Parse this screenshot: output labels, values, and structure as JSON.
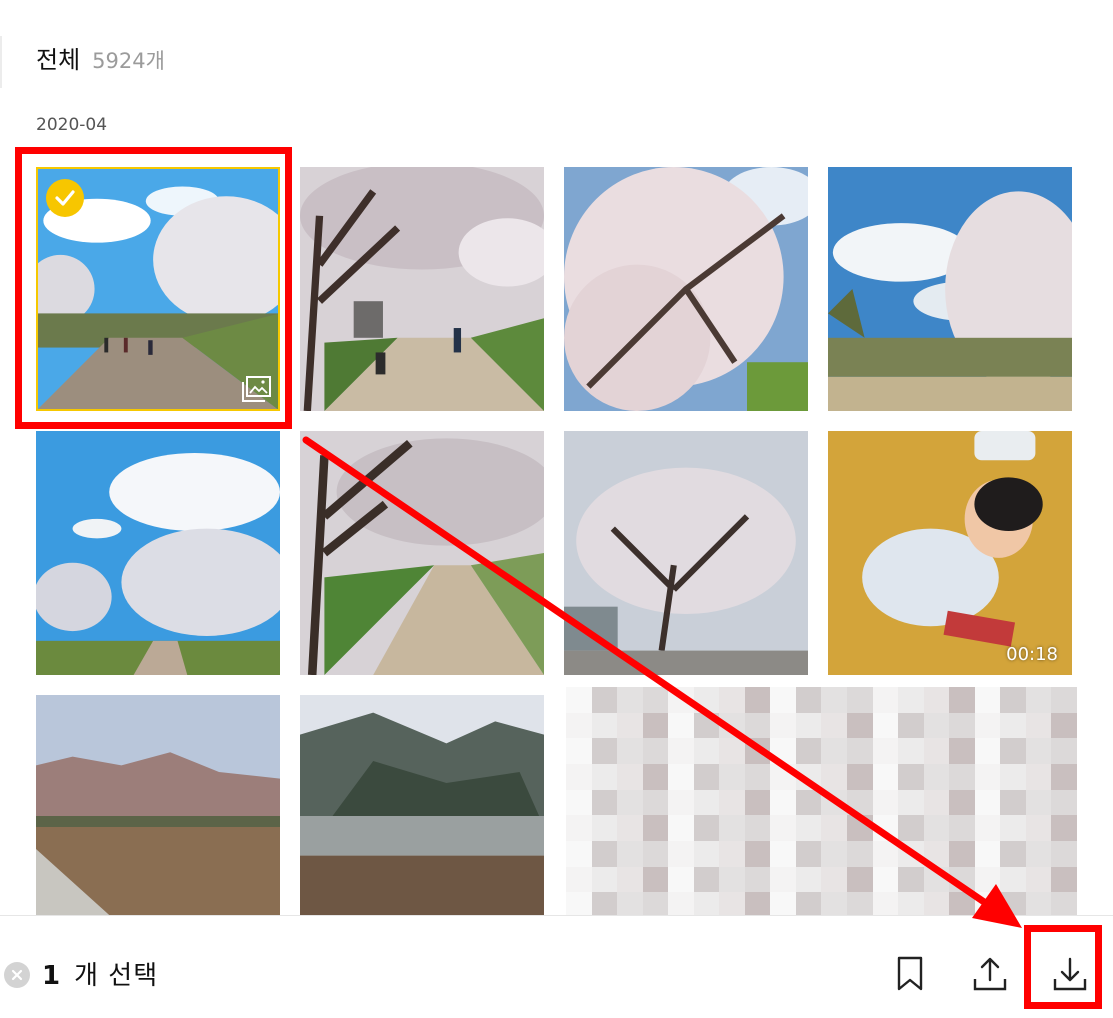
{
  "header": {
    "title": "전체",
    "count": "5924개"
  },
  "section": {
    "date": "2020-04"
  },
  "photos": [
    {
      "name": "cherry-path-selected",
      "selected": true,
      "multi": true
    },
    {
      "name": "cherry-park-children"
    },
    {
      "name": "cherry-blossom-closeup"
    },
    {
      "name": "cherry-tree-sky"
    },
    {
      "name": "cherry-path-clouds"
    },
    {
      "name": "cherry-trees-path"
    },
    {
      "name": "cherry-tree-building"
    },
    {
      "name": "baby-video",
      "duration": "00:18"
    },
    {
      "name": "mountain-field"
    },
    {
      "name": "mountain-village"
    },
    {
      "name": "pixelated-image"
    }
  ],
  "selection_bar": {
    "count": "1",
    "label": "개 선택",
    "actions": [
      "bookmark-icon",
      "share-upload-icon",
      "download-icon"
    ]
  },
  "colors": {
    "accent": "#f7c600",
    "annotation": "#ff0000"
  }
}
